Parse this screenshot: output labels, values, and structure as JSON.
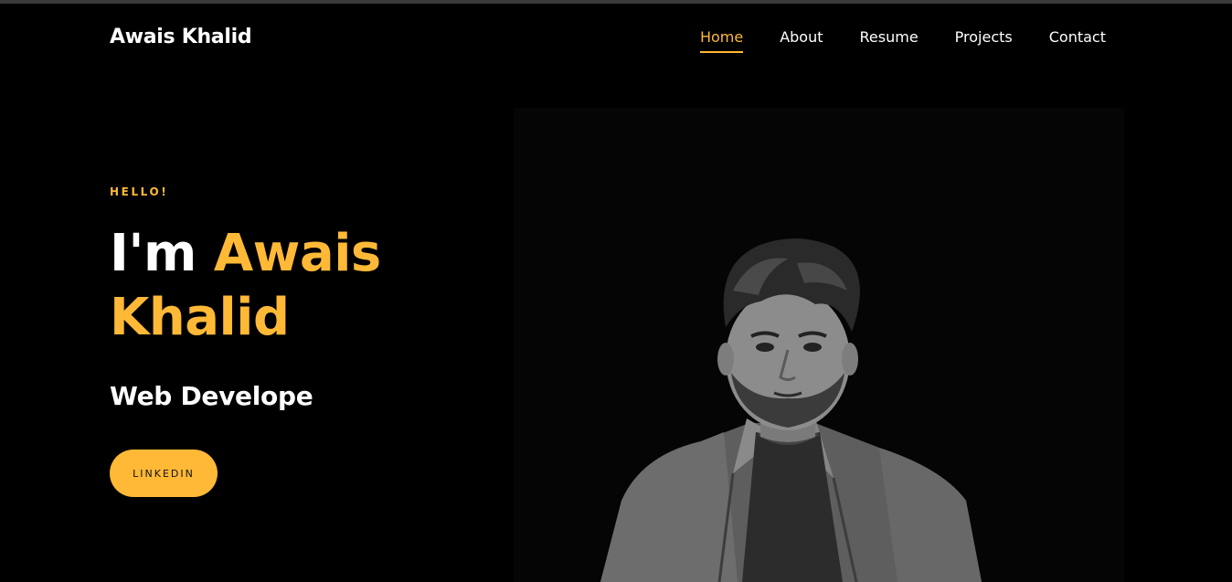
{
  "header": {
    "logo": "Awais Khalid",
    "nav": [
      {
        "label": "Home",
        "active": true
      },
      {
        "label": "About",
        "active": false
      },
      {
        "label": "Resume",
        "active": false
      },
      {
        "label": "Projects",
        "active": false
      },
      {
        "label": "Contact",
        "active": false
      }
    ]
  },
  "hero": {
    "greeting": "HELLO!",
    "headline_prefix": "I'm ",
    "headline_name": "Awais Khalid",
    "role": "Web Develope",
    "cta_label": "LINKEDIN"
  },
  "colors": {
    "background": "#000000",
    "accent": "#ffb936",
    "text": "#ffffff"
  }
}
